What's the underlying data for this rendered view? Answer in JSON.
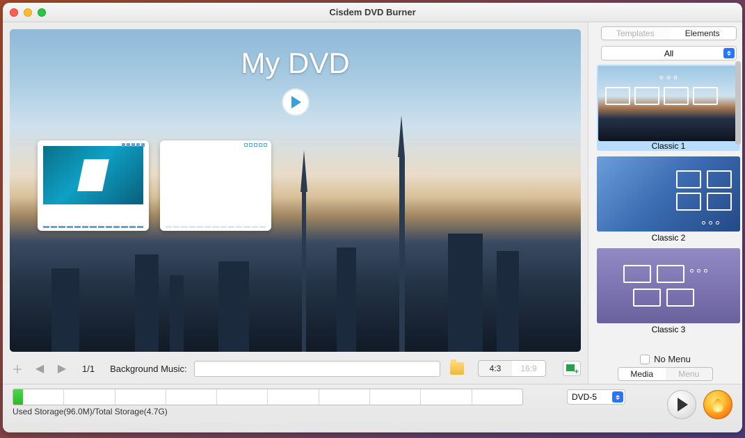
{
  "window": {
    "title": "Cisdem DVD Burner"
  },
  "preview": {
    "dvd_title": "My DVD"
  },
  "toolbar": {
    "page": "1/1",
    "music_label": "Background Music:",
    "ratio_43": "4:3",
    "ratio_169": "16:9"
  },
  "sidebar": {
    "tab_templates": "Templates",
    "tab_elements": "Elements",
    "filter": "All",
    "templates": [
      {
        "label": "Classic 1"
      },
      {
        "label": "Classic 2"
      },
      {
        "label": "Classic 3"
      }
    ],
    "no_menu": "No Menu",
    "bottom_tab_media": "Media",
    "bottom_tab_menu": "Menu"
  },
  "footer": {
    "disc_type": "DVD-5",
    "storage_label": "Used Storage(96.0M)/Total Storage(4.7G)"
  }
}
